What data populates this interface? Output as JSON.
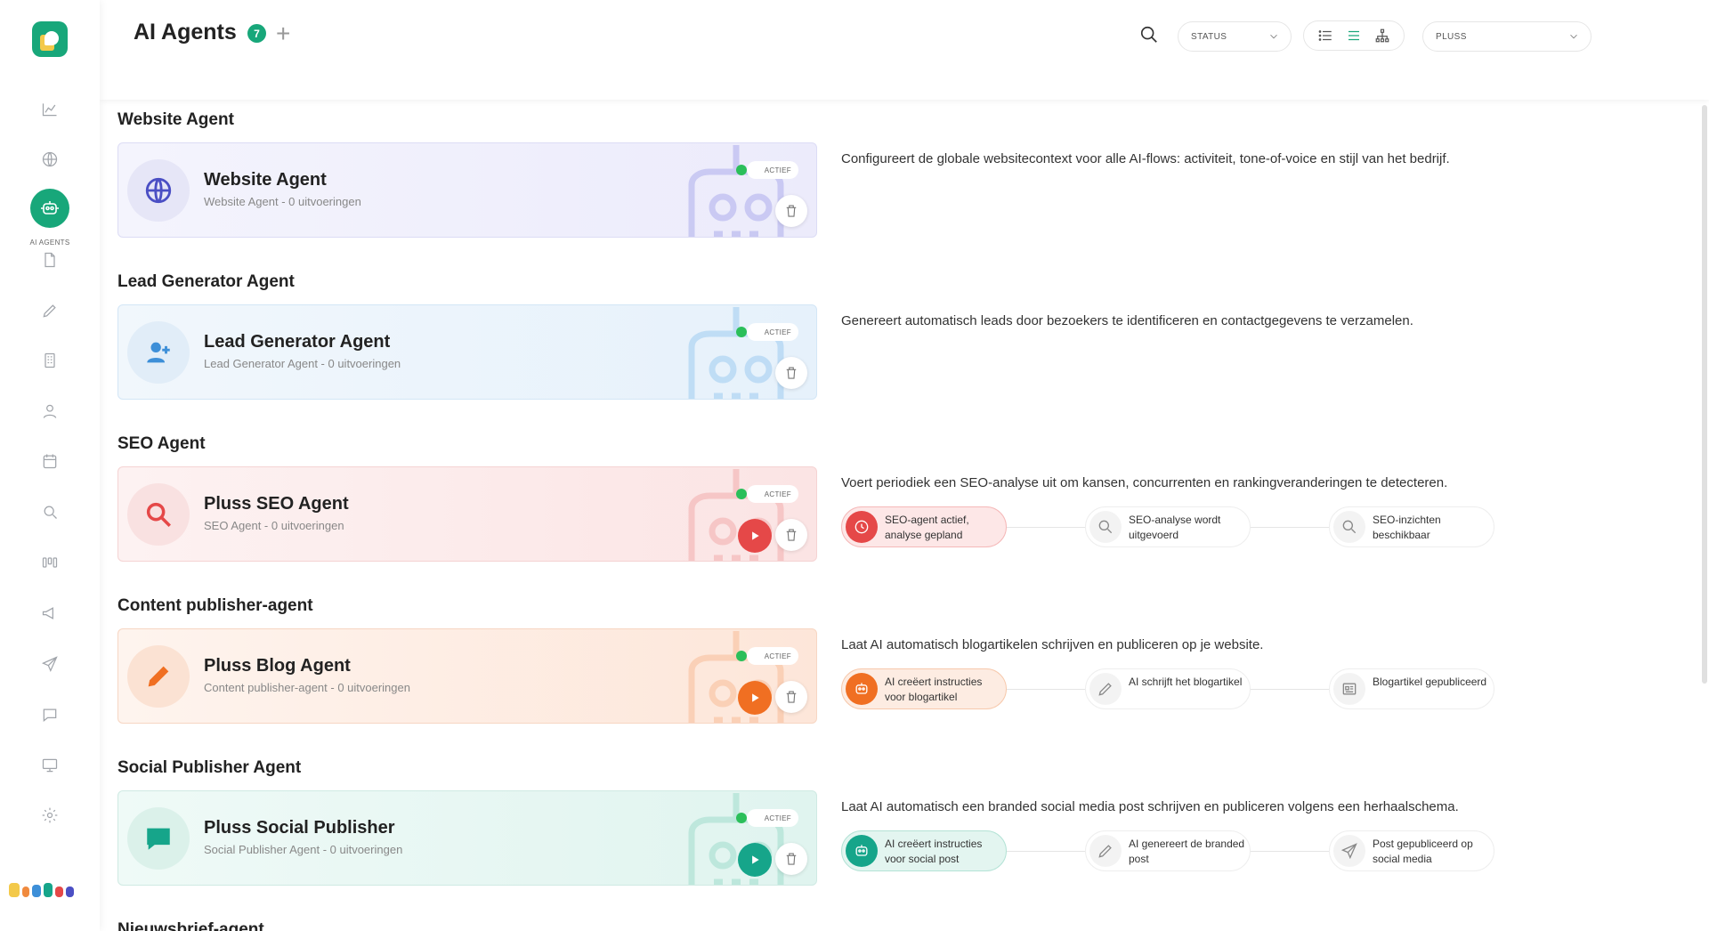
{
  "app": {
    "title": "AI Agents",
    "count": "7"
  },
  "sidebar": {
    "active_label": "AI AGENTS",
    "items": [
      "analytics",
      "websites",
      "ai-agents",
      "documents",
      "edit",
      "buildings",
      "contacts",
      "calendar",
      "search",
      "pipeline",
      "campaigns",
      "send",
      "chat",
      "presentation",
      "settings"
    ]
  },
  "filters": {
    "status": "STATUS",
    "workspace": "PLUSS"
  },
  "sections": [
    {
      "title": "Website Agent",
      "card_name": "Website Agent",
      "card_sub": "Website Agent - 0 uitvoeringen",
      "badge": "ACTIEF",
      "description": "Configureert de globale websitecontext voor alle AI-flows: activiteit, tone-of-voice en stijl van het bedrijf.",
      "color": "#4b4fc4"
    },
    {
      "title": "Lead Generator Agent",
      "card_name": "Lead Generator Agent",
      "card_sub": "Lead Generator Agent - 0 uitvoeringen",
      "badge": "ACTIEF",
      "description": "Genereert automatisch leads door bezoekers te identificeren en contactgegevens te verzamelen.",
      "color": "#3d8fd8"
    },
    {
      "title": "SEO Agent",
      "card_name": "Pluss SEO Agent",
      "card_sub": "SEO Agent - 0 uitvoeringen",
      "badge": "ACTIEF",
      "description": "Voert periodiek een SEO-analyse uit om kansen, concurrenten en rankingveranderingen te detecteren.",
      "color": "#e54848",
      "steps": [
        "SEO-agent actief, analyse gepland",
        "SEO-analyse wordt uitgevoerd",
        "SEO-inzichten beschikbaar"
      ]
    },
    {
      "title": "Content publisher-agent",
      "card_name": "Pluss Blog Agent",
      "card_sub": "Content publisher-agent - 0 uitvoeringen",
      "badge": "ACTIEF",
      "description": "Laat AI automatisch blogartikelen schrijven en publiceren op je website.",
      "color": "#f06f22",
      "steps": [
        "AI creëert instructies voor blogartikel",
        "AI schrijft het blogartikel",
        "Blogartikel gepubliceerd"
      ]
    },
    {
      "title": "Social Publisher Agent",
      "card_name": "Pluss Social Publisher",
      "card_sub": "Social Publisher Agent - 0 uitvoeringen",
      "badge": "ACTIEF",
      "description": "Laat AI automatisch een branded social media post schrijven en publiceren volgens een herhaalschema.",
      "color": "#16a58a",
      "steps": [
        "AI creëert instructies voor social post",
        "AI genereert de branded post",
        "Post gepubliceerd op social media"
      ]
    },
    {
      "title": "Nieuwsbrief-agent"
    }
  ]
}
